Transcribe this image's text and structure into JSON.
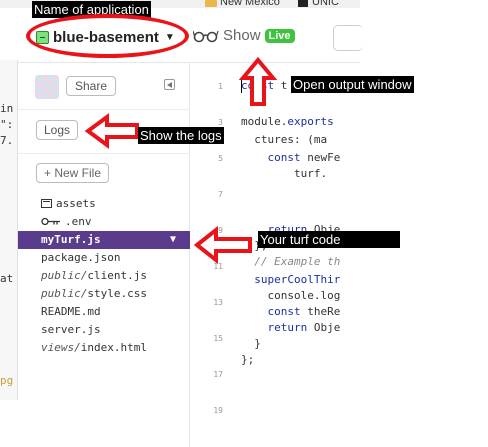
{
  "browser_strip": {
    "bookmark_1": "New Mexico",
    "bookmark_2": "UNIC"
  },
  "left_sliver": {
    "lines": [
      "in",
      "\":",
      "7.",
      "at",
      "pg"
    ]
  },
  "header": {
    "project_name": "blue-basement",
    "show_label": "Show",
    "live_badge": "Live"
  },
  "sidebar": {
    "share_label": "Share",
    "logs_label": "Logs",
    "new_file_label": "+ New File",
    "files": [
      {
        "name": "assets",
        "icon": "folder-icon"
      },
      {
        "name": ".env",
        "icon": "key-icon"
      },
      {
        "name": "myTurf.js",
        "active": true
      },
      {
        "name": "package.json"
      },
      {
        "dir": "public/",
        "name": "client.js"
      },
      {
        "dir": "public/",
        "name": "style.css"
      },
      {
        "name": "README.md"
      },
      {
        "name": "server.js"
      },
      {
        "dir": "views/",
        "name": "index.html"
      }
    ]
  },
  "editor": {
    "gutter": [
      "1",
      "3",
      "5",
      "7",
      "9",
      "11",
      "13",
      "15",
      "17",
      "19"
    ],
    "lines": {
      "l1_kw": "const",
      "l1_rest": " t",
      "l3_a": "module.",
      "l3_b": "exports",
      "l4": "  ctures: (ma",
      "l5_kw": "const",
      "l5_rest": " newFe",
      "l6": "        turf.",
      "l9_kw": "return",
      "l9_rest": " Obje",
      "l10": "  },",
      "l11": "  // Example th",
      "l12": "  superCoolThir",
      "l13": "    console.log",
      "l14_kw": "const",
      "l14_rest": " theRe",
      "l15_kw": "return",
      "l15_rest": " Obje",
      "l16": "  }",
      "l17": "};"
    }
  },
  "annotations": {
    "app_name": "Name of application",
    "output_window": "Open output window",
    "show_logs": "Show the logs",
    "turf_code": "Your turf code"
  },
  "colors": {
    "annotation_red": "#e8141a",
    "active_file": "#5b3b8c",
    "live_green": "#3ec33e"
  }
}
